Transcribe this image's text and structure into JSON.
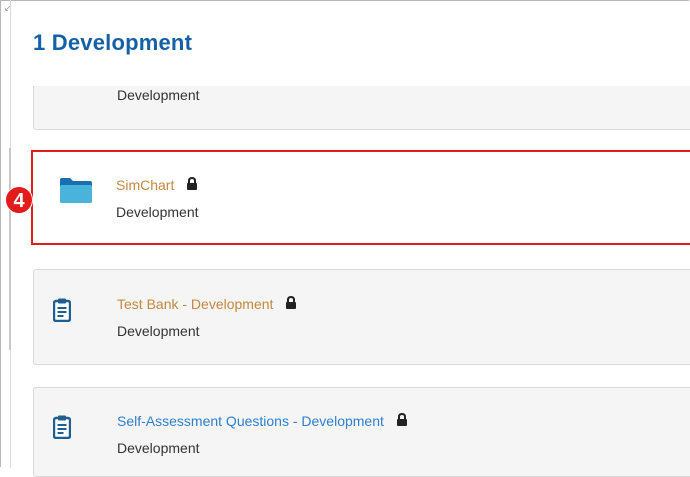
{
  "section": {
    "title": "1 Development"
  },
  "items": [
    {
      "subtitle": "Development"
    },
    {
      "title": "SimChart",
      "subtitle": "Development",
      "icon": "folder-icon",
      "locked": true,
      "title_color": "#c2883f"
    },
    {
      "title": "Test Bank - Development",
      "subtitle": "Development",
      "icon": "document-icon",
      "locked": true,
      "title_color": "#c2883f"
    },
    {
      "title": "Self-Assessment Questions - Development",
      "subtitle": "Development",
      "icon": "document-icon",
      "locked": true,
      "title_color": "#2d7fd0"
    }
  ],
  "annotation": {
    "step_number": "4",
    "color": "#e41b1b"
  }
}
